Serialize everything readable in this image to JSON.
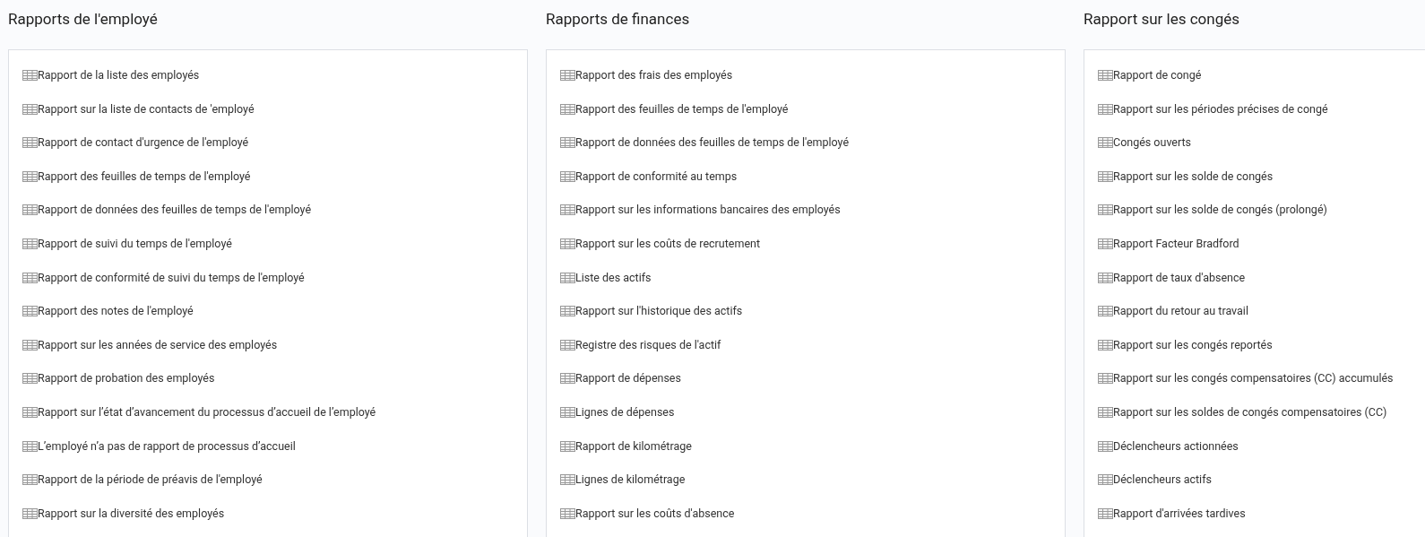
{
  "sections": [
    {
      "title": "Rapports de l'employé",
      "items": [
        "Rapport de la liste des employés",
        "Rapport sur la liste de contacts de 'employé",
        "Rapport de contact d'urgence de l'employé",
        "Rapport des feuilles de temps de l'employé",
        "Rapport de données des feuilles de temps de l'employé",
        "Rapport de suivi du temps de l'employé",
        "Rapport de conformité de suivi du temps de l'employé",
        "Rapport des notes de l'employé",
        "Rapport sur les années de service des employés",
        "Rapport de probation des employés",
        "Rapport sur l’état d’avancement du processus d’accueil de l’employé",
        "L’employé n’a pas de rapport de processus d’accueil",
        "Rapport de la période de préavis de l'employé",
        "Rapport sur la diversité des employés"
      ]
    },
    {
      "title": "Rapports de finances",
      "items": [
        "Rapport des frais des employés",
        "Rapport des feuilles de temps de l'employé",
        "Rapport de données des feuilles de temps de l'employé",
        "Rapport de conformité au temps",
        "Rapport sur les informations bancaires des employés",
        "Rapport sur les coûts de recrutement",
        "Liste des actifs",
        "Rapport sur l'historique des actifs",
        "Registre des risques de l'actif",
        "Rapport de dépenses",
        "Lignes de dépenses",
        "Rapport de kilométrage",
        "Lignes de kilométrage",
        "Rapport sur les coûts d'absence"
      ]
    },
    {
      "title": "Rapport sur les congés",
      "items": [
        "Rapport de congé",
        "Rapport sur les périodes précises de congé",
        "Congés ouverts",
        "Rapport sur les solde de congés",
        "Rapport sur les solde de congés (prolongé)",
        "Rapport Facteur Bradford",
        "Rapport de taux d'absence",
        "Rapport du retour au travail",
        "Rapport sur les congés reportés",
        "Rapport sur les congés compensatoires (CC) accumulés",
        "Rapport sur les soldes de congés compensatoires (CC)",
        "Déclencheurs actionnées",
        "Déclencheurs actifs",
        "Rapport d'arrivées tardives"
      ]
    }
  ]
}
